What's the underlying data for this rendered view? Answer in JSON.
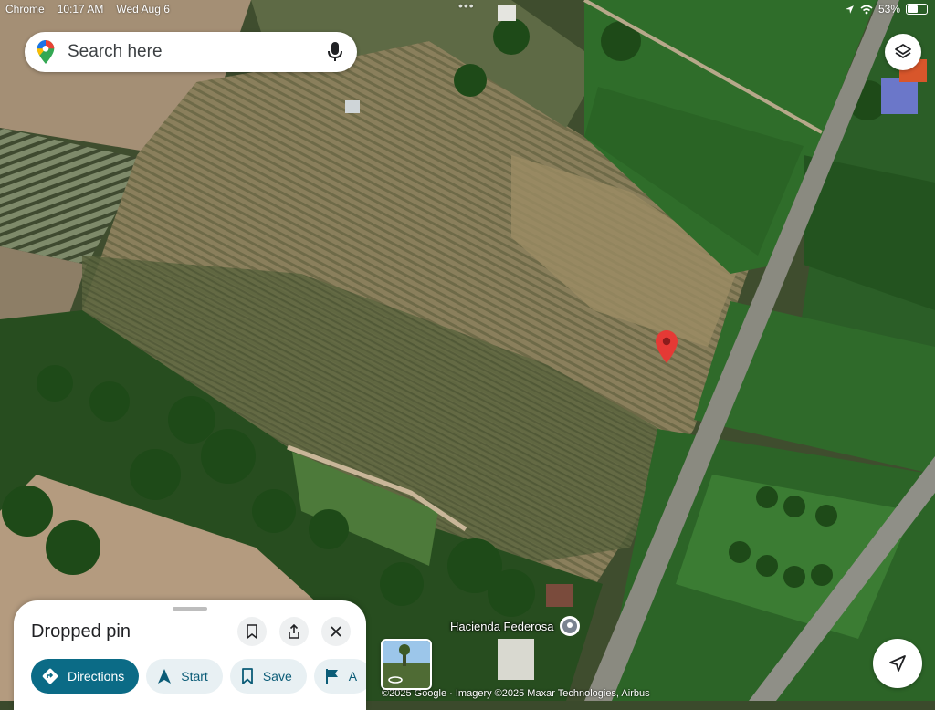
{
  "status_bar": {
    "app": "Chrome",
    "time": "10:17 AM",
    "date": "Wed Aug 6",
    "battery": "53%",
    "battery_level": 0.53
  },
  "search": {
    "placeholder": "Search here"
  },
  "map": {
    "place_label": "Hacienda Federosa",
    "attribution": "©2025 Google · Imagery ©2025 Maxar Technologies, Airbus"
  },
  "sheet": {
    "title": "Dropped pin",
    "actions": [
      {
        "label": "Directions",
        "icon": "directions-icon"
      },
      {
        "label": "Start",
        "icon": "navigation-arrow-icon"
      },
      {
        "label": "Save",
        "icon": "bookmark-icon"
      },
      {
        "label": "A",
        "icon": "flag-icon"
      }
    ]
  },
  "colors": {
    "accent": "#0b6b86",
    "pin": "#e53935"
  }
}
